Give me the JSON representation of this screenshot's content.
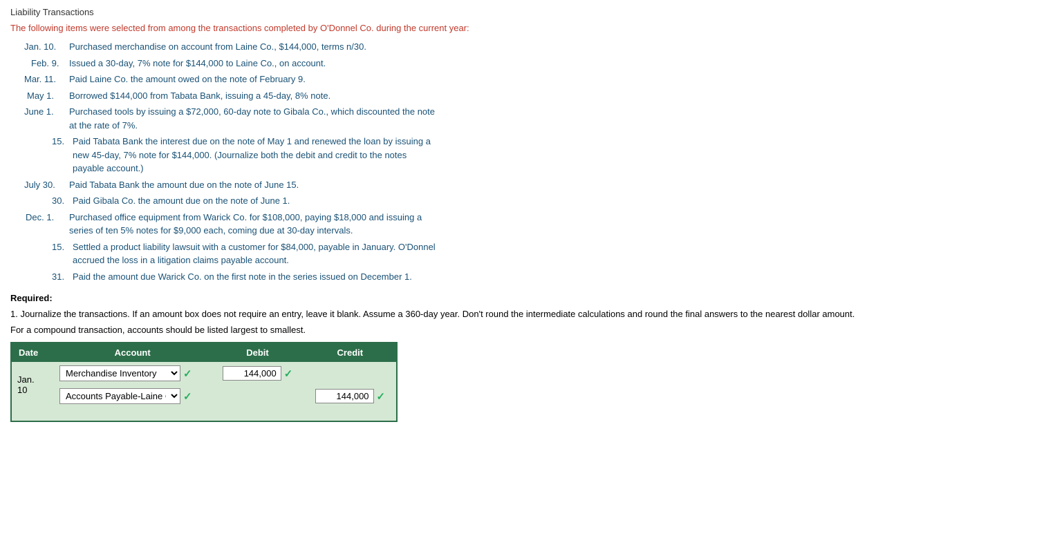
{
  "page": {
    "title": "Liability Transactions",
    "intro": "The following items were selected from among the transactions completed by O'Donnel Co. during the current year:",
    "transactions": [
      {
        "date": "Jan. 10.",
        "desc": "Purchased merchandise on account from Laine Co., $144,000, terms n/30."
      },
      {
        "date": "Feb. 9.",
        "desc": "Issued a 30-day, 7% note for $144,000 to Laine Co., on account."
      },
      {
        "date": "Mar. 11.",
        "desc": "Paid Laine Co. the amount owed on the note of February 9."
      },
      {
        "date": "May 1.",
        "desc": "Borrowed $144,000 from Tabata Bank, issuing a 45-day, 8% note."
      },
      {
        "date": "June 1.",
        "desc": "Purchased tools by issuing a $72,000, 60-day note to Gibala Co., which discounted the note at the rate of 7%."
      },
      {
        "date": "15.",
        "desc": "Paid Tabata Bank the interest due on the note of May 1 and renewed the loan by issuing a new 45-day, 7% note for $144,000. (Journalize both the debit and credit to the notes payable account.)"
      },
      {
        "date": "July 30.",
        "desc": "Paid Tabata Bank the amount due on the note of June 15."
      },
      {
        "date": "30.",
        "desc": "Paid Gibala Co. the amount due on the note of June 1."
      },
      {
        "date": "Dec. 1.",
        "desc": "Purchased office equipment from Warick Co. for $108,000, paying $18,000 and issuing a series of ten 5% notes for $9,000 each, coming due at 30-day intervals."
      },
      {
        "date": "15.",
        "desc": "Settled a product liability lawsuit with a customer for $84,000, payable in January. O'Donnel accrued the loss in a litigation claims payable account."
      },
      {
        "date": "31.",
        "desc": "Paid the amount due Warick Co. on the first note in the series issued on December 1."
      }
    ],
    "required_label": "Required:",
    "instruction": "1.  Journalize the transactions. If an amount box does not require an entry, leave it blank. Assume a 360-day year. Don't round the intermediate calculations and round the final answers to the nearest dollar amount.",
    "compound_note": "For a compound transaction, accounts should be listed largest to smallest.",
    "table": {
      "headers": {
        "date": "Date",
        "account": "Account",
        "debit": "Debit",
        "credit": "Credit"
      },
      "rows": [
        {
          "date": "Jan.\n10",
          "debit_account": "Merchandise Inventory",
          "debit_amount": "144,000",
          "credit_account": "Accounts Payable-Laine Co.",
          "credit_amount": "144,000"
        }
      ]
    }
  }
}
